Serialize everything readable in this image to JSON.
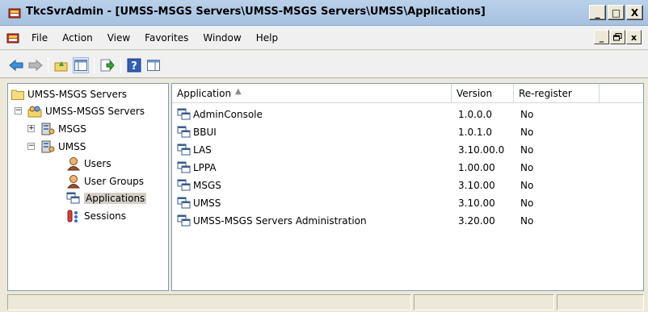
{
  "window": {
    "title": "TkcSvrAdmin - [UMSS-MSGS Servers\\UMSS-MSGS Servers\\UMSS\\Applications]",
    "minimize_label": "_",
    "maximize_label": "□",
    "close_label": "X"
  },
  "menubar": {
    "items": [
      "File",
      "Action",
      "View",
      "Favorites",
      "Window",
      "Help"
    ],
    "mdi_minimize": "_",
    "mdi_restore": "ₗ",
    "mdi_close": "x"
  },
  "toolbar": {
    "buttons": [
      "back-icon",
      "forward-icon",
      "up-folder-icon",
      "show-hide-tree-icon",
      "export-list-icon",
      "help-icon",
      "properties-pane-icon"
    ]
  },
  "tree": {
    "root": "UMSS-MSGS Servers",
    "server_group": "UMSS-MSGS Servers",
    "msgs": "MSGS",
    "umss": "UMSS",
    "children": [
      "Users",
      "User Groups",
      "Applications",
      "Sessions"
    ],
    "selected": "Applications"
  },
  "list": {
    "columns": [
      "Application",
      "Version",
      "Re-register"
    ],
    "rows": [
      {
        "application": "AdminConsole",
        "version": "1.0.0.0",
        "reregister": "No"
      },
      {
        "application": "BBUI",
        "version": "1.0.1.0",
        "reregister": "No"
      },
      {
        "application": "LAS",
        "version": "3.10.00.0",
        "reregister": "No"
      },
      {
        "application": "LPPA",
        "version": "1.00.00",
        "reregister": "No"
      },
      {
        "application": "MSGS",
        "version": "3.10.00",
        "reregister": "No"
      },
      {
        "application": "UMSS",
        "version": "3.10.00",
        "reregister": "No"
      },
      {
        "application": "UMSS-MSGS Servers Administration",
        "version": "3.20.00",
        "reregister": "No"
      }
    ]
  },
  "colors": {
    "title_gradient_top": "#b9d1ea",
    "pane_border": "#7f9db9",
    "selection": "#d4d0c8"
  }
}
